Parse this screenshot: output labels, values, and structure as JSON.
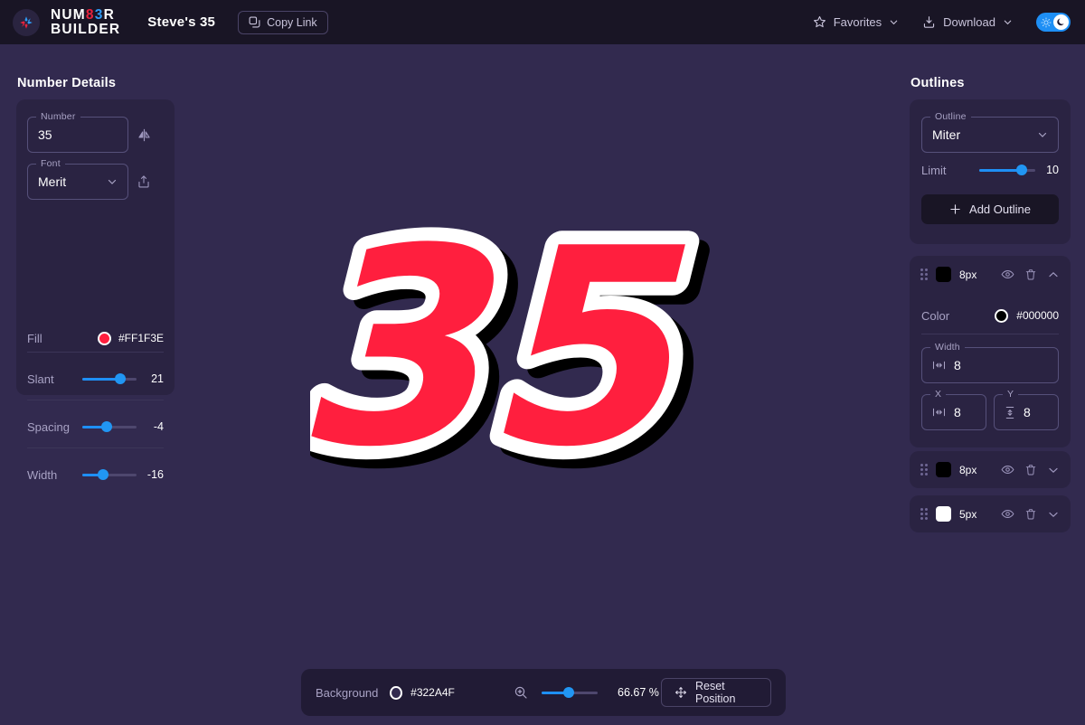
{
  "header": {
    "logo_line1": "NUMB3R",
    "logo_line1_a": "NUM",
    "logo_line1_8": "8",
    "logo_line1_3": "3",
    "logo_line1_r": "R",
    "logo_line2": "BUILDER",
    "doc_title": "Steve's 35",
    "copy_link_label": "Copy Link",
    "favorites_label": "Favorites",
    "download_label": "Download",
    "theme_toggle_state": "dark"
  },
  "left_panel": {
    "title": "Number Details",
    "number_field": {
      "legend": "Number",
      "value": "35"
    },
    "font_field": {
      "legend": "Font",
      "value": "Merit"
    },
    "fill": {
      "label": "Fill",
      "hex": "#FF1F3E"
    },
    "sliders": [
      {
        "label": "Slant",
        "value": "21",
        "percent": 70
      },
      {
        "label": "Spacing",
        "value": "-4",
        "percent": 45
      },
      {
        "label": "Width",
        "value": "-16",
        "percent": 38
      }
    ]
  },
  "right_panel": {
    "title": "Outlines",
    "outline_field": {
      "legend": "Outline",
      "value": "Miter"
    },
    "limit": {
      "label": "Limit",
      "value": "10",
      "percent": 75
    },
    "add_outline_label": "Add Outline",
    "layers": [
      {
        "width_px": "8px",
        "swatch": "#000000",
        "expanded": true,
        "color_label": "Color",
        "color_hex": "#000000",
        "width_legend": "Width",
        "width_value": "8",
        "x_legend": "X",
        "x_value": "8",
        "y_legend": "Y",
        "y_value": "8"
      },
      {
        "width_px": "8px",
        "swatch": "#000000",
        "expanded": false
      },
      {
        "width_px": "5px",
        "swatch": "#FFFFFF",
        "expanded": false
      }
    ]
  },
  "canvas": {
    "number_text": "35",
    "fill_color": "#FF1F3E",
    "outline_color": "#FFFFFF",
    "shadow_color": "#000000",
    "background": "#322A4F"
  },
  "bottom_bar": {
    "background_label": "Background",
    "background_hex": "#322A4F",
    "zoom_value": "66.67 %",
    "zoom_percent": 48,
    "reset_label": "Reset Position"
  }
}
